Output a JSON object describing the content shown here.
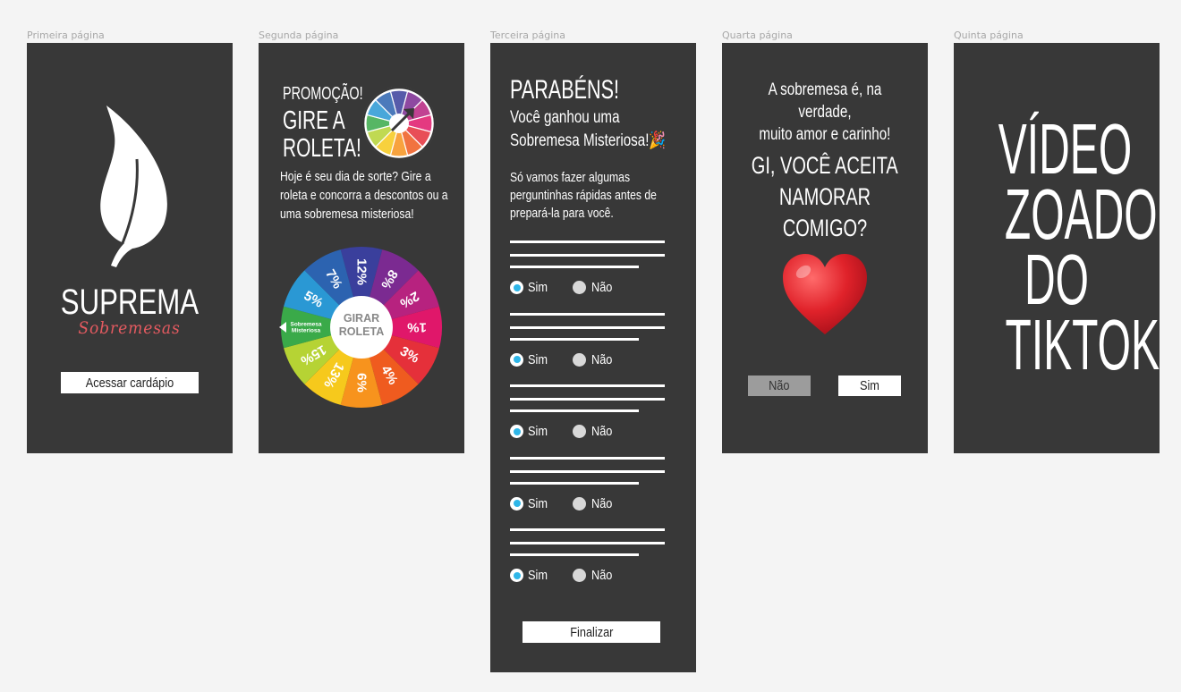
{
  "frames": {
    "p1": {
      "label": "Primeira página"
    },
    "p2": {
      "label": "Segunda página"
    },
    "p3": {
      "label": "Terceira página"
    },
    "p4": {
      "label": "Quarta página"
    },
    "p5": {
      "label": "Quinta página"
    }
  },
  "page1": {
    "logo_icon": "leaf-icon",
    "brand_name": "SUPREMA",
    "brand_sub": "Sobremesas",
    "brand_sub_color": "#e45a60",
    "menu_button": "Acessar cardápio"
  },
  "page2": {
    "promo": "PROMOÇÃO!",
    "title_line1": "GIRE A",
    "title_line2": "ROLETA!",
    "wheel_icon": "roulette-icon",
    "description": "Hoje é seu dia de sorte? Gire a roleta e concorra a descontos ou a uma sobremesa misteriosa!",
    "spin_button_line1": "GIRAR",
    "spin_button_line2": "ROLETA",
    "wheel_segments": [
      {
        "label": "12%",
        "color": "#3a3f9c"
      },
      {
        "label": "8%",
        "color": "#7b2a91"
      },
      {
        "label": "2%",
        "color": "#b7227f"
      },
      {
        "label": "1%",
        "color": "#e0176a"
      },
      {
        "label": "3%",
        "color": "#e5303a"
      },
      {
        "label": "4%",
        "color": "#ef5b1f"
      },
      {
        "label": "6%",
        "color": "#f7931d"
      },
      {
        "label": "13%",
        "color": "#f6c91c"
      },
      {
        "label": "15%",
        "color": "#b6d334"
      },
      {
        "label": "Sobremesa Misteriosa",
        "color": "#3aaa49"
      },
      {
        "label": "5%",
        "color": "#2a98d4"
      },
      {
        "label": "7%",
        "color": "#2c63b0"
      }
    ]
  },
  "page3": {
    "title": "PARABÉNS!",
    "subtitle_line1": "Você ganhou uma",
    "subtitle_line2": "Sobremesa Misteriosa!🎉",
    "intro": "Só vamos fazer algumas perguntinhas rápidas antes de prepará-la para você.",
    "questions": [
      {
        "yes": "Sim",
        "no": "Não",
        "selected": "Sim"
      },
      {
        "yes": "Sim",
        "no": "Não",
        "selected": "Sim"
      },
      {
        "yes": "Sim",
        "no": "Não",
        "selected": "Sim"
      },
      {
        "yes": "Sim",
        "no": "Não",
        "selected": "Sim"
      },
      {
        "yes": "Sim",
        "no": "Não",
        "selected": "Sim"
      }
    ],
    "finish_button": "Finalizar",
    "radio_color": "#2eb6e8"
  },
  "page4": {
    "message_line1": "A sobremesa é, na verdade,",
    "message_line2": "muito amor e carinho!",
    "question_line1": "GI, VOCÊ ACEITA",
    "question_line2": "NAMORAR COMIGO?",
    "heart_icon": "heart-icon",
    "heart_color": "#e0222a",
    "no_button": "Não",
    "yes_button": "Sim"
  },
  "page5": {
    "line1": "VÍDEO",
    "line2": "ZOADO",
    "line3": "DO",
    "line4": "TIKTOK"
  },
  "colors": {
    "canvas": "#f4f4f4",
    "frame": "#383838"
  }
}
